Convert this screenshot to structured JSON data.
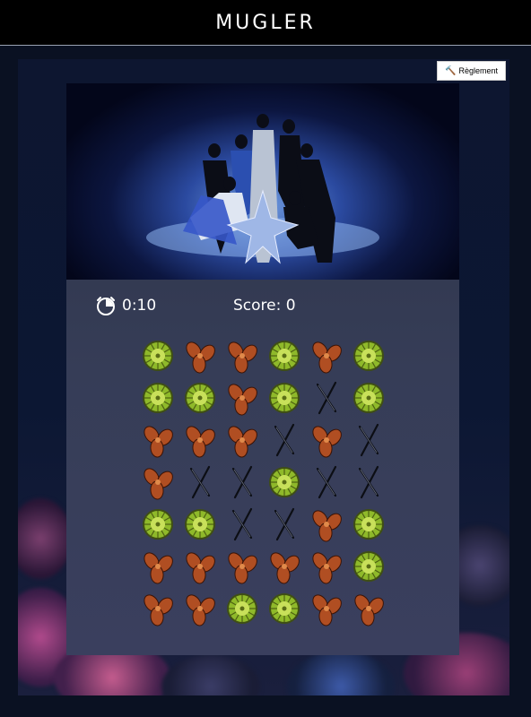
{
  "header": {
    "brand": "MUGLER"
  },
  "rules_button": {
    "label": "Règlement",
    "icon": "magic-wand-icon"
  },
  "hud": {
    "timer_icon": "stopwatch-icon",
    "timer": "0:10",
    "score": "Score: 0"
  },
  "colors": {
    "lime": "#8fb92a",
    "copper": "#b04e22",
    "needle": "#0c0e14"
  },
  "board": {
    "rows": [
      [
        "lime",
        "petal",
        "petal",
        "lime",
        "petal",
        "lime"
      ],
      [
        "lime",
        "lime",
        "petal",
        "lime",
        "needle",
        "lime"
      ],
      [
        "petal",
        "petal",
        "petal",
        "needle",
        "petal",
        "needle"
      ],
      [
        "petal",
        "needle",
        "needle",
        "lime",
        "needle",
        "needle"
      ],
      [
        "lime",
        "lime",
        "needle",
        "needle",
        "petal",
        "lime"
      ],
      [
        "petal",
        "petal",
        "petal",
        "petal",
        "petal",
        "lime"
      ],
      [
        "petal",
        "petal",
        "lime",
        "lime",
        "petal",
        "petal"
      ]
    ]
  }
}
